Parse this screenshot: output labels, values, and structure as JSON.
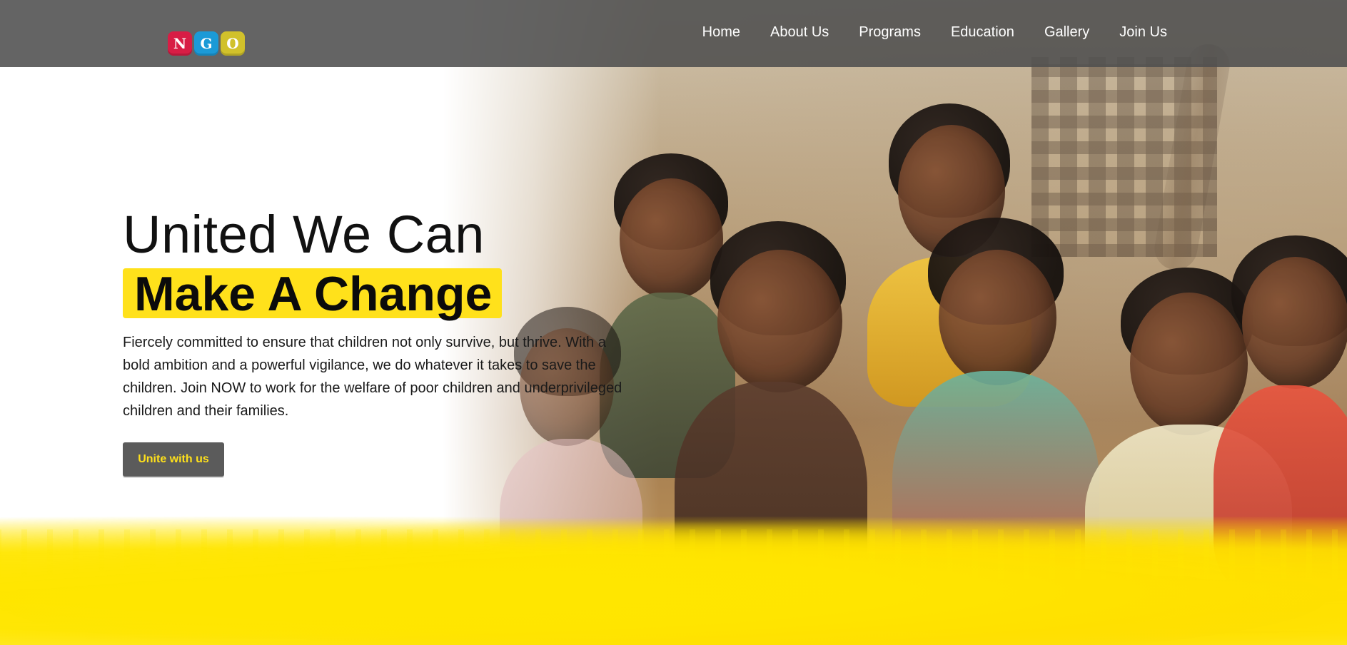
{
  "header": {
    "logo": {
      "tiles": [
        {
          "letter": "N",
          "color": "#d81d45"
        },
        {
          "letter": "G",
          "color": "#1b9ad7"
        },
        {
          "letter": "O",
          "color": "#d1c12b"
        }
      ]
    },
    "nav": [
      {
        "label": "Home"
      },
      {
        "label": "About Us"
      },
      {
        "label": "Programs"
      },
      {
        "label": "Education"
      },
      {
        "label": "Gallery"
      },
      {
        "label": "Join Us"
      }
    ]
  },
  "hero": {
    "title_line_1": "United We Can",
    "title_line_2": "Make A Change",
    "description": "Fiercely committed to ensure that children not only survive, but thrive. With a bold ambition and a powerful vigilance, we do whatever it takes to save the children. Join NOW to work for the welfare of poor children and underprivileged children and their families.",
    "cta_label": "Unite with us"
  },
  "theme": {
    "accent_yellow": "#ffe11b",
    "header_bg": "#4e4e4e",
    "button_bg": "#5b5b5b"
  }
}
